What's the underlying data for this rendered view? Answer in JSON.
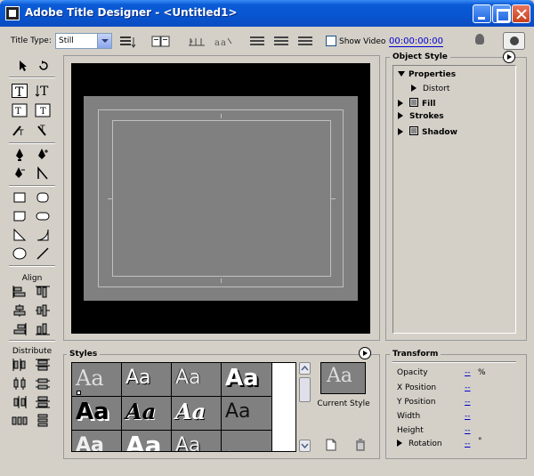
{
  "window": {
    "title": "Adobe Title Designer - <Untitled1>"
  },
  "toolbar": {
    "title_type_label": "Title Type:",
    "title_type_value": "Still",
    "show_video_label": "Show Video",
    "show_video_checked": false,
    "timecode": "00:00:00:00"
  },
  "tools": {
    "align_label": "Align",
    "distribute_label": "Distribute"
  },
  "object_style": {
    "title": "Object Style",
    "items": [
      {
        "label": "Properties",
        "expanded": true
      },
      {
        "label": "Distort",
        "expanded": false
      },
      {
        "label": "Fill",
        "expanded": false,
        "enabled": true
      },
      {
        "label": "Strokes",
        "expanded": false
      },
      {
        "label": "Shadow",
        "expanded": false,
        "enabled": false
      }
    ]
  },
  "styles": {
    "title": "Styles",
    "swatch_text": "Aa",
    "current_style_label": "Current Style"
  },
  "transform": {
    "title": "Transform",
    "rows": [
      {
        "label": "Opacity",
        "value": "--",
        "unit": "%"
      },
      {
        "label": "X Position",
        "value": "--",
        "unit": ""
      },
      {
        "label": "Y Position",
        "value": "--",
        "unit": ""
      },
      {
        "label": "Width",
        "value": "--",
        "unit": ""
      },
      {
        "label": "Height",
        "value": "--",
        "unit": ""
      },
      {
        "label": "Rotation",
        "value": "--",
        "unit": "°"
      }
    ]
  },
  "colors": {
    "titlebar": "#0855d0",
    "chrome": "#d4d0c8",
    "canvas_bg": "#000000",
    "canvas_frame": "#808080",
    "link_value": "#0000cc"
  }
}
